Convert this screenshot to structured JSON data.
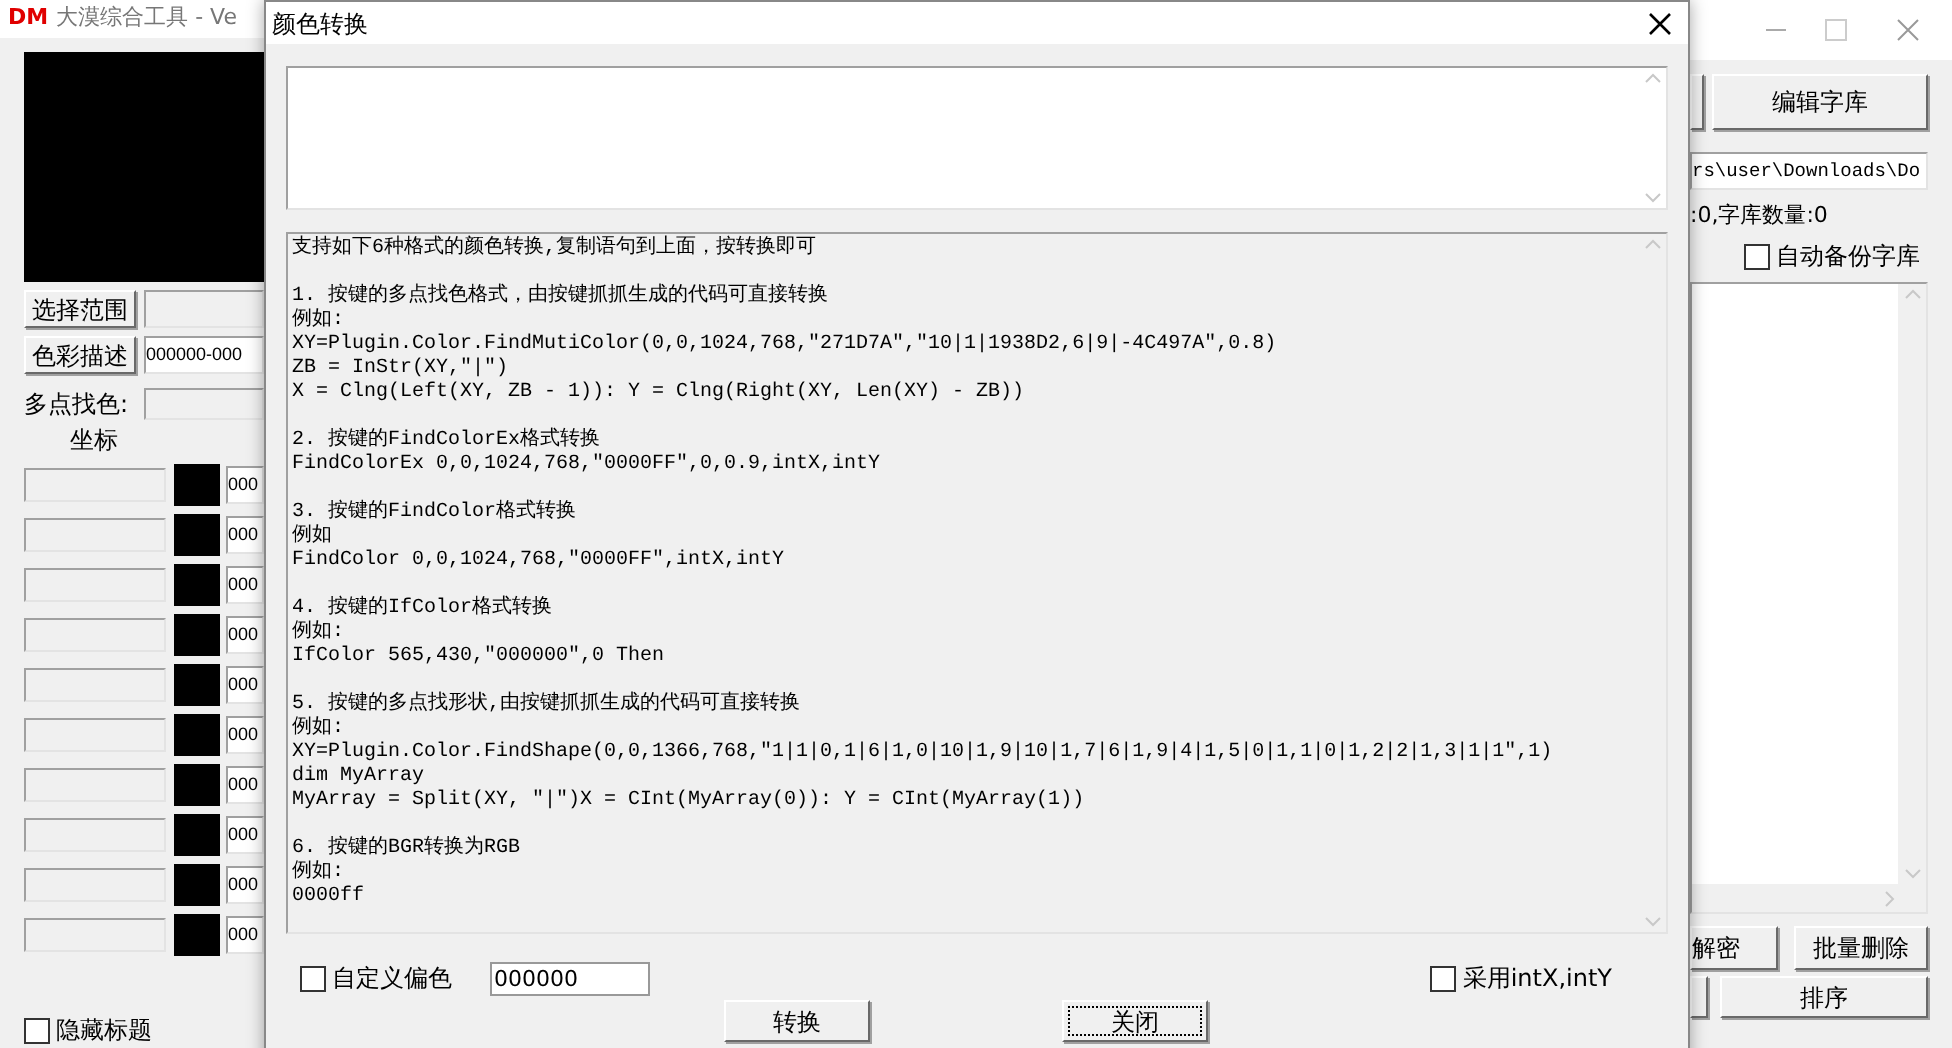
{
  "main_window": {
    "app_icon": "DM",
    "title": "大漠综合工具 - Ve"
  },
  "left_panel": {
    "select_range_button": "选择范围",
    "color_desc_button": "色彩描述",
    "color_desc_value": "000000-000",
    "multipoint_label": "多点找色:",
    "coord_header": "坐标",
    "rows": [
      {
        "value": "000"
      },
      {
        "value": "000"
      },
      {
        "value": "000"
      },
      {
        "value": "000"
      },
      {
        "value": "000"
      },
      {
        "value": "000"
      },
      {
        "value": "000"
      },
      {
        "value": "000"
      },
      {
        "value": "000"
      },
      {
        "value": "000"
      }
    ],
    "hide_title": {
      "label": "隐藏标题",
      "checked": false
    }
  },
  "right_panel": {
    "edit_lib_button": "编辑字库",
    "path": "rs\\user\\Downloads\\Do",
    "lib_info": ":0,字库数量:0",
    "auto_backup": {
      "label": "自动备份字库",
      "checked": false
    },
    "decrypt_button": "解密",
    "batch_delete_button": "批量删除",
    "sort_button": "排序"
  },
  "dialog": {
    "title": "颜色转换",
    "intro": "支持如下6种格式的颜色转换,复制语句到上面，按转换即可",
    "sections": [
      {
        "lines": [
          "1. 按键的多点找色格式，由按键抓抓生成的代码可直接转换",
          "例如:",
          "XY=Plugin.Color.FindMutiColor(0,0,1024,768,\"271D7A\",\"10|1|1938D2,6|9|-4C497A\",0.8)",
          "ZB = InStr(XY,\"|\")",
          "X = Clng(Left(XY, ZB - 1)): Y = Clng(Right(XY, Len(XY) - ZB))"
        ]
      },
      {
        "lines": [
          "2. 按键的FindColorEx格式转换",
          "FindColorEx 0,0,1024,768,\"0000FF\",0,0.9,intX,intY"
        ]
      },
      {
        "lines": [
          "3. 按键的FindColor格式转换",
          "例如",
          "FindColor 0,0,1024,768,\"0000FF\",intX,intY"
        ]
      },
      {
        "lines": [
          "4. 按键的IfColor格式转换",
          "例如:",
          "IfColor 565,430,\"000000\",0 Then"
        ]
      },
      {
        "lines": [
          "5. 按键的多点找形状,由按键抓抓生成的代码可直接转换",
          "例如:",
          "XY=Plugin.Color.FindShape(0,0,1366,768,\"1|1|0,1|6|1,0|10|1,9|10|1,7|6|1,9|4|1,5|0|1,1|0|1,2|2|1,3|1|1\",1)",
          "dim MyArray",
          "MyArray = Split(XY, \"|\")X = CInt(MyArray(0)): Y = CInt(MyArray(1))"
        ]
      },
      {
        "lines": [
          "6. 按键的BGR转换为RGB",
          "例如:",
          "0000ff"
        ]
      }
    ],
    "custom_offset": {
      "label": "自定义偏色",
      "checked": false,
      "value": "000000"
    },
    "use_intxy": {
      "label": "采用intX,intY",
      "checked": false
    },
    "buttons": [
      {
        "label": "转换",
        "focused": false
      },
      {
        "label": "关闭",
        "focused": true
      }
    ]
  }
}
